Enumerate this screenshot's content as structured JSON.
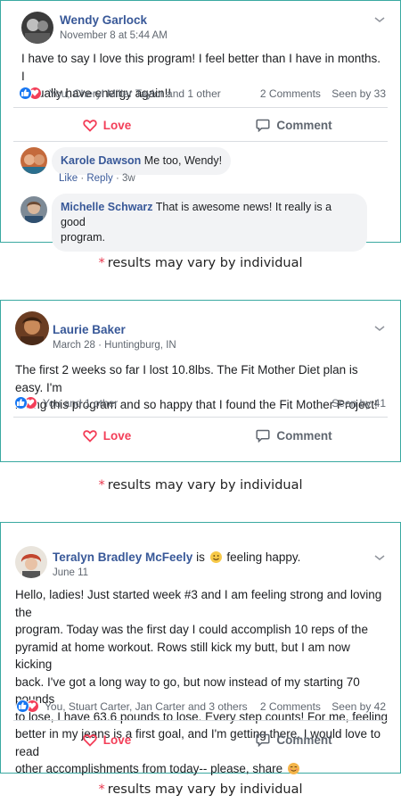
{
  "posts": [
    {
      "author": "Wendy Garlock",
      "meta": "November 8 at 5:44 AM",
      "text_lines": [
        "I have to say I love this program! I feel better than I have in months. I",
        "actually have energy again!!"
      ],
      "reactions_names": "You, Cheryl Miller Taylor and 1 other",
      "comments_count": "2 Comments",
      "seen_by": "Seen by 33",
      "love_label": "Love",
      "comment_label": "Comment",
      "comments": [
        {
          "author": "Karole Dawson",
          "text": " Me too, Wendy!",
          "like": "Like",
          "reply": "Reply",
          "time": "3w"
        },
        {
          "author": "Michelle Schwarz",
          "text_line1": " That is awesome news! It really is a good",
          "text_line2": "program."
        }
      ]
    },
    {
      "author": "Laurie Baker",
      "meta": "March 28 · Huntingburg, IN",
      "text_lines": [
        "The first 2 weeks so far I lost 10.8lbs. The Fit Mother Diet plan is easy. I'm",
        "loving this program and so happy that I found the Fit Mother Project!"
      ],
      "reactions_names": "You and 1 other",
      "seen_by": "Seen by 41",
      "love_label": "Love",
      "comment_label": "Comment"
    },
    {
      "author": "Teralyn Bradley McFeely",
      "feeling_prefix": " is ",
      "feeling_text": " feeling happy.",
      "meta": "June 11",
      "text_lines": [
        "Hello, ladies! Just started week #3 and I am feeling strong and loving the",
        "program. Today was the first day I could accomplish 10 reps of the",
        "pyramid at home workout. Rows still kick my butt, but I am now kicking",
        "back. I've got a long way to go, but now instead of my starting 70 pounds",
        "to lose, I have 63.6 pounds to lose. Every step counts! For me, feeling",
        "better in my jeans is a first goal, and I'm getting there. I would love to read",
        "other accomplishments from today-- please, share"
      ],
      "reactions_names": "You, Stuart Carter, Jan Carter and 3 others",
      "comments_count": "2 Comments",
      "seen_by": "Seen by 42",
      "love_label": "Love",
      "comment_label": "Comment"
    }
  ],
  "disclaimer": {
    "star": "*",
    "text": "results may vary by individual"
  },
  "colors": {
    "card_border": "#3aa9a1",
    "name_link": "#385898",
    "love_red": "#f33e58",
    "like_blue": "#1877f2",
    "star_red": "#e8334a"
  },
  "icons": [
    "chevron-down-icon",
    "like-reaction-icon",
    "love-reaction-icon",
    "heart-outline-icon",
    "comment-bubble-icon",
    "smiley-icon"
  ]
}
